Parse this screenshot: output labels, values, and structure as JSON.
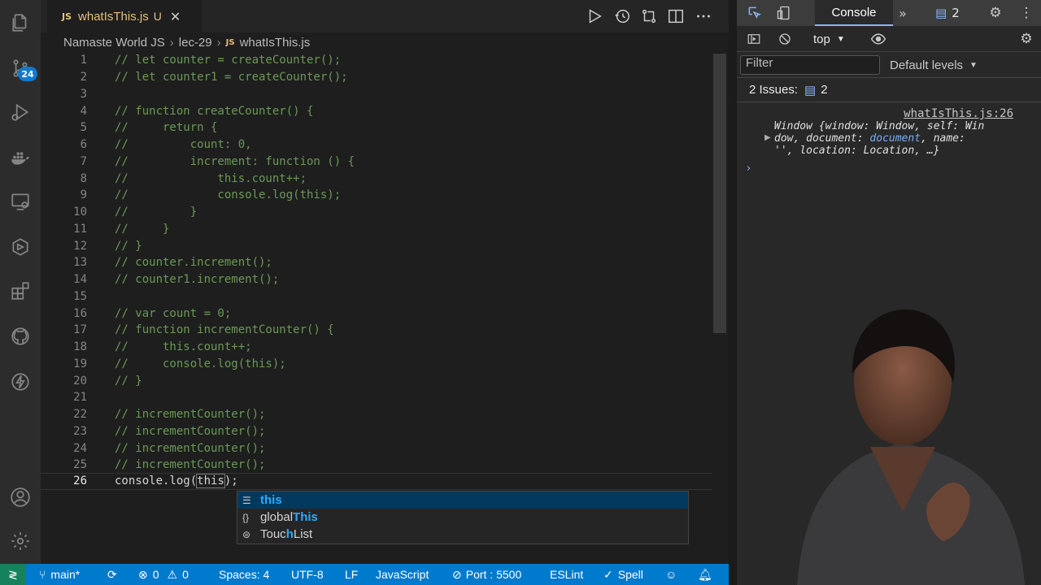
{
  "colors": {
    "editor_bg": "#1e1e1e",
    "comment": "#6a9955",
    "status_bar": "#007acc",
    "accent": "#0e7ad1",
    "tab_text": "#e5c07b"
  },
  "activity_bar": {
    "items": [
      "explorer-icon",
      "source-control-icon",
      "run-debug-icon",
      "docker-icon",
      "remote-explorer-icon",
      "live-share-icon",
      "extensions-icon",
      "github-icon",
      "thunder-icon",
      "account-icon",
      "settings-gear-icon"
    ],
    "source_control_badge": "24"
  },
  "tab": {
    "lang": "JS",
    "name": "whatIsThis.js",
    "status": "U"
  },
  "breadcrumb": [
    "Namaste World JS",
    "lec-29",
    "whatIsThis.js"
  ],
  "editor": {
    "lines": [
      {
        "n": "1",
        "text": "// let counter = createCounter();"
      },
      {
        "n": "2",
        "text": "// let counter1 = createCounter();"
      },
      {
        "n": "3",
        "text": ""
      },
      {
        "n": "4",
        "text": "// function createCounter() {"
      },
      {
        "n": "5",
        "text": "//     return {"
      },
      {
        "n": "6",
        "text": "//         count: 0,"
      },
      {
        "n": "7",
        "text": "//         increment: function () {"
      },
      {
        "n": "8",
        "text": "//             this.count++;"
      },
      {
        "n": "9",
        "text": "//             console.log(this);"
      },
      {
        "n": "10",
        "text": "//         }"
      },
      {
        "n": "11",
        "text": "//     }"
      },
      {
        "n": "12",
        "text": "// }"
      },
      {
        "n": "13",
        "text": "// counter.increment();"
      },
      {
        "n": "14",
        "text": "// counter1.increment();"
      },
      {
        "n": "15",
        "text": ""
      },
      {
        "n": "16",
        "text": "// var count = 0;"
      },
      {
        "n": "17",
        "text": "// function incrementCounter() {"
      },
      {
        "n": "18",
        "text": "//     this.count++;"
      },
      {
        "n": "19",
        "text": "//     console.log(this);"
      },
      {
        "n": "20",
        "text": "// }"
      },
      {
        "n": "21",
        "text": ""
      },
      {
        "n": "22",
        "text": "// incrementCounter();"
      },
      {
        "n": "23",
        "text": "// incrementCounter();"
      },
      {
        "n": "24",
        "text": "// incrementCounter();"
      },
      {
        "n": "25",
        "text": "// incrementCounter();"
      }
    ],
    "active_line": {
      "n": "26",
      "prefix": "console.log(",
      "selected": "this",
      "suffix": ");"
    }
  },
  "suggestions": [
    {
      "icon": "keyword-icon",
      "glyph": "☰",
      "before": "",
      "match": "this",
      "after": "",
      "selected": true
    },
    {
      "icon": "namespace-icon",
      "glyph": "{}",
      "before": "global",
      "match": "This",
      "after": "",
      "selected": false
    },
    {
      "icon": "interface-icon",
      "glyph": "⊜",
      "before": "Touc",
      "match": "h",
      "after": "List",
      "selected": false
    }
  ],
  "status_bar": {
    "branch": "main*",
    "errors": "0",
    "warnings": "0",
    "spaces": "Spaces: 4",
    "encoding": "UTF-8",
    "eol": "LF",
    "language": "JavaScript",
    "port": "Port : 5500",
    "eslint": "ESLint",
    "spell": "Spell"
  },
  "devtools": {
    "active_tab": "Console",
    "issues_badge": "2",
    "context": "top",
    "filter_placeholder": "Filter",
    "levels": "Default levels",
    "issues_label": "2 Issues:",
    "issues_count": "2",
    "log_source": "whatIsThis.js:26",
    "log_parts": {
      "p1": "Window {",
      "k1": "window",
      "v1": ": Window, ",
      "k2": "self",
      "v2": ": Win",
      "p2": "dow, ",
      "k3": "document",
      "v3": ": ",
      "v3b": "document",
      "p3": ", ",
      "k4": "name",
      "p4": ":",
      "p5": "'', ",
      "k5": "location",
      "v5": ": Location, …}"
    }
  }
}
